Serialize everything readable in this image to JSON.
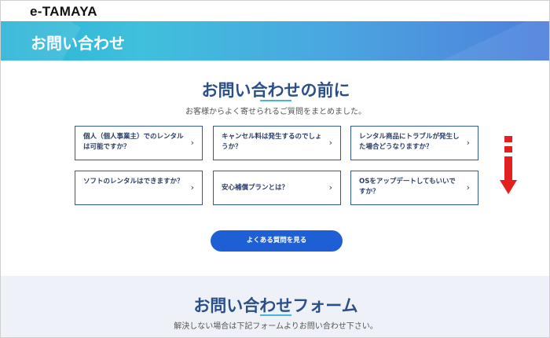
{
  "header": {
    "logo": "e-TAMAYA"
  },
  "banner": {
    "title": "お問い合わせ"
  },
  "faq_section": {
    "title": "お問い合わせの前に",
    "subtitle": "お客様からよく寄せられるご質問をまとめました。",
    "items": [
      {
        "label": "個人（個人事業主）でのレンタルは可能ですか？"
      },
      {
        "label": "キャンセル料は発生するのでしょうか？"
      },
      {
        "label": "レンタル商品にトラブルが発生した場合どうなりますか？"
      },
      {
        "label": "ソフトのレンタルはできますか？"
      },
      {
        "label": "安心補償プランとは？"
      },
      {
        "label": "OSをアップデートしてもいいですか？"
      }
    ],
    "more_button": "よくある質問を見る"
  },
  "form_section": {
    "title": "お問い合わせフォーム",
    "subtitle": "解決しない場合は下記フォームよりお問い合わせ下さい。"
  },
  "icons": {
    "chevron": "›",
    "scroll_arrow": "red-down-arrow-icon"
  },
  "colors": {
    "accent": "#1f5fd6",
    "title": "#2b4f88",
    "arrow": "#e32020"
  }
}
